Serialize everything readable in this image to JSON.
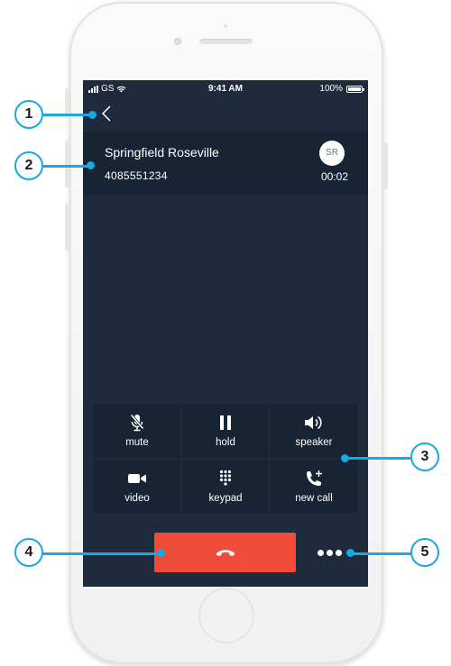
{
  "status_bar": {
    "carrier": "GS",
    "time": "9:41 AM",
    "battery": "100%"
  },
  "contact": {
    "name": "Springfield Roseville",
    "number": "4085551234",
    "initials": "SR",
    "call_duration": "00:02"
  },
  "controls": [
    {
      "label": "mute",
      "icon": "microphone-muted-icon"
    },
    {
      "label": "hold",
      "icon": "pause-icon"
    },
    {
      "label": "speaker",
      "icon": "speaker-icon"
    },
    {
      "label": "video",
      "icon": "video-camera-icon"
    },
    {
      "label": "keypad",
      "icon": "keypad-icon"
    },
    {
      "label": "new call",
      "icon": "add-call-icon"
    }
  ],
  "end_call": {
    "icon": "hang-up-icon",
    "color": "#ee4c39"
  },
  "more": {
    "icon": "more-dots-icon"
  },
  "callouts": [
    "1",
    "2",
    "3",
    "4",
    "5"
  ],
  "colors": {
    "screen_bg": "#1d2b3c",
    "card_bg": "#172433",
    "accent": "#1ba7df",
    "end_call": "#ee4c39"
  }
}
